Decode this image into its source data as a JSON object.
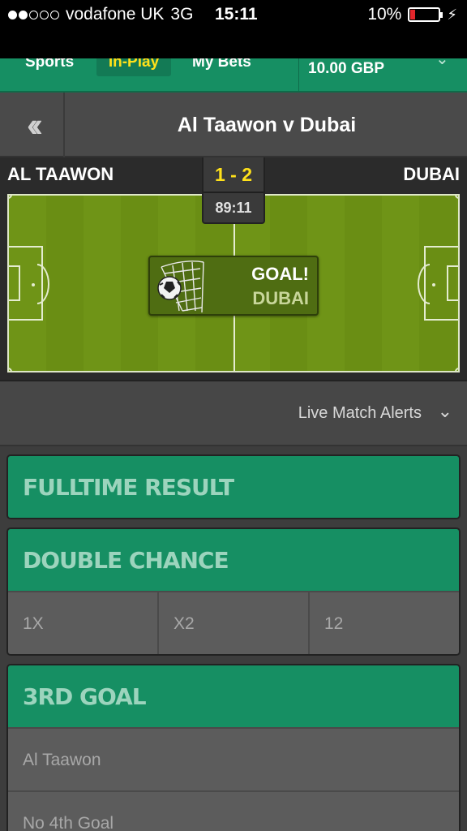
{
  "status": {
    "carrier": "vodafone UK",
    "network": "3G",
    "time": "15:11",
    "battery": "10%",
    "signal_bars_filled": 2,
    "signal_bars_total": 5
  },
  "nav": {
    "sports": "Sports",
    "inplay": "In-Play",
    "mybets": "My Bets",
    "balance": "10.00 GBP",
    "active_color": "#ffe11a"
  },
  "header": {
    "title": "Al Taawon v Dubai",
    "back_glyph": "‹‹"
  },
  "match": {
    "home": "AL TAAWON",
    "away": "DUBAI",
    "score": "1 - 2",
    "clock": "89:11",
    "event_title": "GOAL!",
    "event_team": "DUBAI"
  },
  "alerts": {
    "label": "Live Match Alerts"
  },
  "markets": {
    "fulltime": {
      "title": "FULLTIME RESULT"
    },
    "double_chance": {
      "title": "DOUBLE CHANCE",
      "options": [
        "1X",
        "X2",
        "12"
      ]
    },
    "third_goal": {
      "title": "3RD GOAL",
      "options": [
        "Al Taawon",
        "No 4th Goal"
      ]
    }
  },
  "colors": {
    "brand_green": "#168f63",
    "score_yellow": "#ffe11a",
    "pitch_green": "#6f9417"
  }
}
